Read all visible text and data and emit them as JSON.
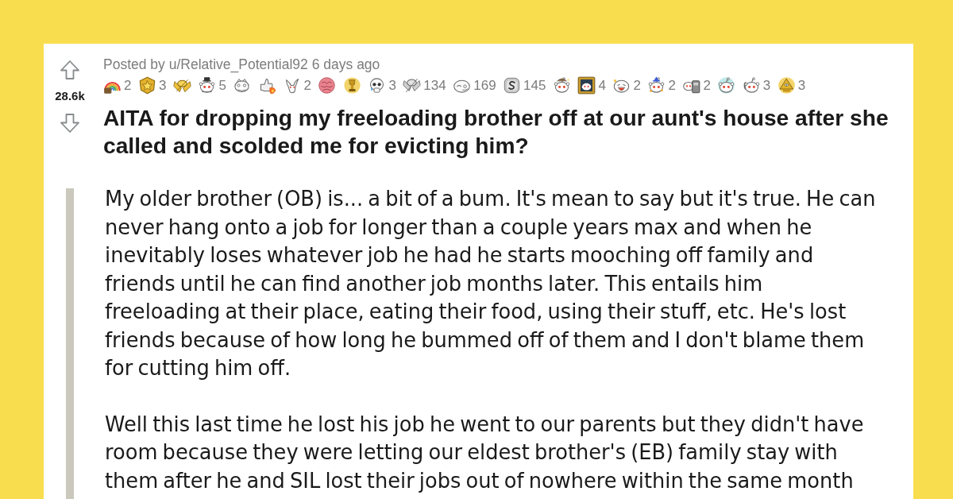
{
  "post": {
    "score": "28.6k",
    "byline": {
      "prefix": "Posted by",
      "author": "u/Relative_Potential92",
      "age": "6 days ago"
    },
    "awards": [
      {
        "kind": "rainbow",
        "count": "2"
      },
      {
        "kind": "starbadge",
        "count": "3"
      },
      {
        "kind": "handshake"
      },
      {
        "kind": "tophat",
        "count": "5"
      },
      {
        "kind": "creature"
      },
      {
        "kind": "thumbsup"
      },
      {
        "kind": "goat",
        "count": "2"
      },
      {
        "kind": "brain"
      },
      {
        "kind": "trophy"
      },
      {
        "kind": "skull",
        "count": "3"
      },
      {
        "kind": "hands",
        "count": "134"
      },
      {
        "kind": "face",
        "count": "169"
      },
      {
        "kind": "coin",
        "count": "145"
      },
      {
        "kind": "cap"
      },
      {
        "kind": "frame",
        "count": "4"
      },
      {
        "kind": "laughing",
        "count": "2"
      },
      {
        "kind": "wizard",
        "count": "2"
      },
      {
        "kind": "machine",
        "count": "2"
      },
      {
        "kind": "halo"
      },
      {
        "kind": "waving",
        "count": "3"
      },
      {
        "kind": "pyramid",
        "count": "3"
      }
    ],
    "title": "AITA for dropping my freeloading brother off at our aunt's house after she called and scolded me for evicting him?",
    "body": [
      "My older brother (OB) is... a bit of a bum. It's mean to say but it's true. He can never hang onto a job for longer than a couple years max and when he inevitably loses whatever job he had he starts mooching off family and friends until he can find another job months later. This entails him freeloading at their place, eating their food, using their stuff, etc. He's lost friends because of how long he bummed off of them and I don't blame them for cutting him off.",
      "Well this last time he lost his job he went to our parents but they didn't have room because they were letting our eldest brother's (EB) family stay with them after he and SIL lost their jobs out of nowhere within the same month"
    ]
  }
}
